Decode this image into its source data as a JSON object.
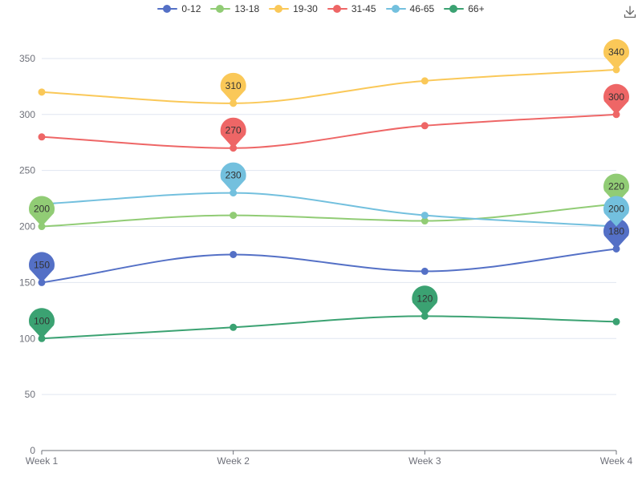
{
  "chart_data": {
    "type": "line",
    "smooth": true,
    "categories": [
      "Week 1",
      "Week 2",
      "Week 3",
      "Week 4"
    ],
    "ylim": [
      0,
      370
    ],
    "yticks": [
      0,
      50,
      100,
      150,
      200,
      250,
      300,
      350
    ],
    "grid": "horizontal",
    "legend_position": "top-center",
    "series": [
      {
        "name": "0-12",
        "color": "#5470c6",
        "values": [
          150,
          175,
          160,
          180
        ],
        "markers": [
          {
            "index": 0,
            "value": 150
          },
          {
            "index": 3,
            "value": 180
          }
        ]
      },
      {
        "name": "13-18",
        "color": "#91cc75",
        "values": [
          200,
          210,
          205,
          220
        ],
        "markers": [
          {
            "index": 0,
            "value": 200
          },
          {
            "index": 3,
            "value": 220
          }
        ]
      },
      {
        "name": "19-30",
        "color": "#fac858",
        "values": [
          320,
          310,
          330,
          340
        ],
        "markers": [
          {
            "index": 1,
            "value": 310
          },
          {
            "index": 3,
            "value": 340
          }
        ]
      },
      {
        "name": "31-45",
        "color": "#ee6666",
        "values": [
          280,
          270,
          290,
          300
        ],
        "markers": [
          {
            "index": 1,
            "value": 270
          },
          {
            "index": 3,
            "value": 300
          }
        ]
      },
      {
        "name": "46-65",
        "color": "#73c0de",
        "values": [
          220,
          230,
          210,
          200
        ],
        "markers": [
          {
            "index": 1,
            "value": 230
          },
          {
            "index": 3,
            "value": 200
          }
        ]
      },
      {
        "name": "66+",
        "color": "#3ba272",
        "values": [
          100,
          110,
          120,
          115
        ],
        "markers": [
          {
            "index": 0,
            "value": 100
          },
          {
            "index": 2,
            "value": 120
          }
        ]
      }
    ]
  },
  "toolbox": {
    "icon": "download-icon"
  }
}
